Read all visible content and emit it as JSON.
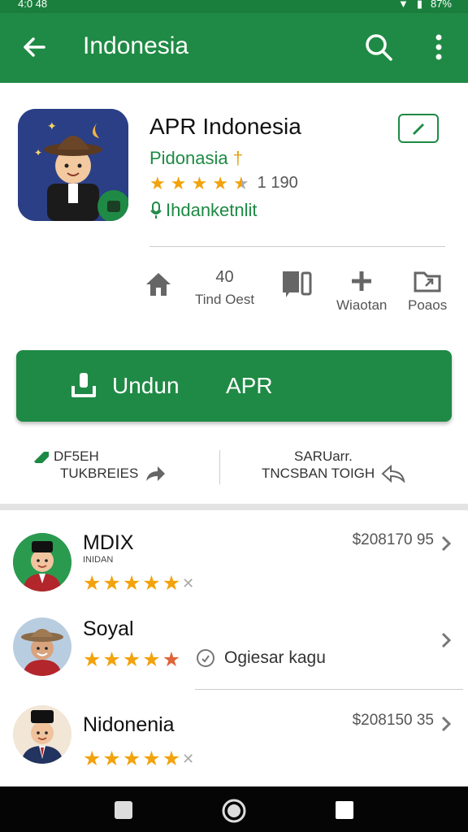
{
  "status": {
    "time": "4:0 48",
    "battery": "87%"
  },
  "appbar": {
    "title": "Indonesia",
    "back_icon": "arrow-back-icon",
    "search_icon": "search-icon",
    "more_icon": "more-vert-icon",
    "color": "#1f8a45"
  },
  "app": {
    "name": "APR Indonesia",
    "developer": "Pidonasia",
    "developer_mark": "†",
    "rating_count": "1 190",
    "tag": "Ihdanketnlit",
    "stars": 4.5
  },
  "stats": [
    {
      "icon": "home-icon",
      "value": "",
      "label": ""
    },
    {
      "icon": "downloads-icon",
      "value": "40",
      "label": "Tind Oest"
    },
    {
      "icon": "book-icon",
      "value": "",
      "label": ""
    },
    {
      "icon": "plus-icon",
      "value": "",
      "label": "Wiaotan"
    },
    {
      "icon": "folder-icon",
      "value": "",
      "label": "Poaos"
    }
  ],
  "install": {
    "label": "Undun",
    "label2": "APR"
  },
  "actions": {
    "left": {
      "line1": "DF5EH",
      "line2": "TUKBREIES"
    },
    "right": {
      "line1": "SARUarr.",
      "line2": "TNCSBAN TOIGH"
    }
  },
  "list": [
    {
      "name": "MDIX",
      "sub": "INIDAN",
      "price": "$208170 95",
      "stars": 5,
      "note": ""
    },
    {
      "name": "Soyal",
      "sub": "",
      "price": "",
      "stars": 4.5,
      "note": "Ogiesar kagu"
    },
    {
      "name": "Nidonenia",
      "sub": "",
      "price": "$208150 35",
      "stars": 5,
      "note": ""
    }
  ]
}
